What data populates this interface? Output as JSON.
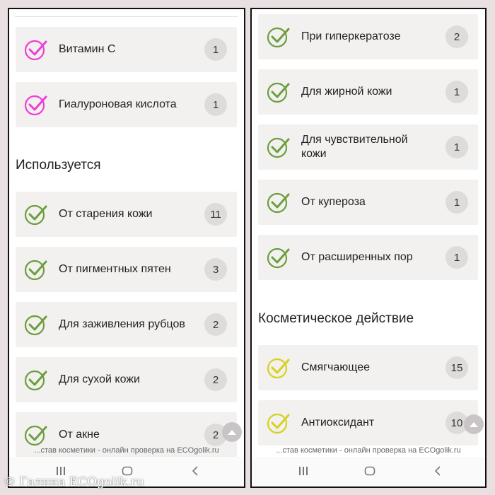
{
  "colors": {
    "magenta_check": "#ee3fd8",
    "green_check": "#6c9e3e",
    "yellow_check": "#d7d11f",
    "card_bg": "#f2f1ef",
    "count_bg": "#dddcda"
  },
  "left": {
    "items_top": [
      {
        "label": "Витамин С",
        "count": "1",
        "icon": "magenta-check-circle-icon"
      },
      {
        "label": "Гиалуроновая кислота",
        "count": "1",
        "icon": "magenta-check-circle-icon"
      }
    ],
    "section_title": "Используется",
    "items_used": [
      {
        "label": "От старения кожи",
        "count": "11",
        "icon": "green-check-circle-icon"
      },
      {
        "label": "От пигментных пятен",
        "count": "3",
        "icon": "green-check-circle-icon"
      },
      {
        "label": "Для заживления рубцов",
        "count": "2",
        "icon": "green-check-circle-icon"
      },
      {
        "label": "Для сухой кожи",
        "count": "2",
        "icon": "green-check-circle-icon"
      },
      {
        "label": "От акне",
        "count": "2",
        "icon": "green-check-circle-icon"
      }
    ],
    "footer": "...став косметики - онлайн проверка на ECOgolik.ru"
  },
  "right": {
    "items_used": [
      {
        "label": "При гиперкератозе",
        "count": "2",
        "icon": "green-check-circle-icon"
      },
      {
        "label": "Для жирной кожи",
        "count": "1",
        "icon": "green-check-circle-icon"
      },
      {
        "label": "Для чувствительной кожи",
        "count": "1",
        "icon": "green-check-circle-icon"
      },
      {
        "label": "От купероза",
        "count": "1",
        "icon": "green-check-circle-icon"
      },
      {
        "label": "От расширенных пор",
        "count": "1",
        "icon": "green-check-circle-icon"
      }
    ],
    "section_title": "Косметическое действие",
    "items_action": [
      {
        "label": "Смягчающее",
        "count": "15",
        "icon": "yellow-check-circle-icon"
      },
      {
        "label": "Антиоксидант",
        "count": "10",
        "icon": "yellow-check-circle-icon"
      }
    ],
    "footer": "...став косметики - онлайн проверка на ECOgolik.ru"
  },
  "navbar": {
    "recents": "recents-icon",
    "home": "home-icon",
    "back": "back-icon"
  },
  "watermark": "© Галина ECOgolik.ru"
}
